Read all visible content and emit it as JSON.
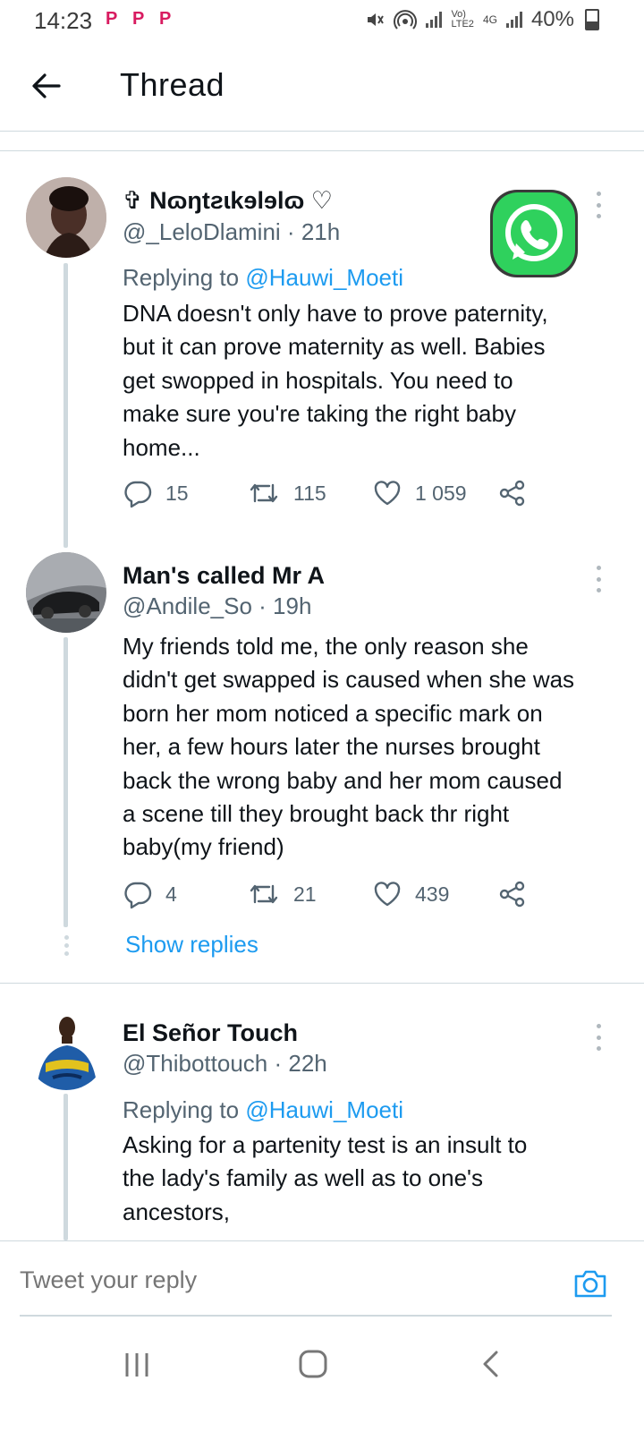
{
  "status": {
    "time": "14:23",
    "notification_icons": [
      "P",
      "P",
      "P"
    ],
    "network_label_top": "Vo)",
    "network_label_bottom": "LTE2",
    "network_type": "4G",
    "battery": "40%"
  },
  "header": {
    "title": "Thread",
    "back_icon": "arrow-left-icon"
  },
  "tweets": [
    {
      "name": "✞ Nɷŋtƨɩkɘlɘlɷ ♡",
      "handle": "@_LeloDlamini",
      "time": "21h",
      "replying_prefix": "Replying to",
      "replying_to": "@Hauwi_Moeti",
      "lines": [
        "DNA doesn't only have to prove paternity,",
        "but it can prove maternity as well. Babies",
        "get swopped in hospitals. You need to",
        "make sure you're taking the right baby",
        "home..."
      ],
      "replies": "15",
      "retweets": "115",
      "likes": "1 059"
    },
    {
      "name": "Man's called Mr A",
      "handle": "@Andile_So",
      "time": "19h",
      "lines": [
        "My friends told me, the only reason she",
        "didn't get swapped is caused when she was",
        "born her mom noticed a specific mark on",
        "her, a few hours later the nurses brought",
        "back the wrong baby and her mom caused",
        "a scene till they brought back thr right",
        "baby(my friend)"
      ],
      "replies": "4",
      "retweets": "21",
      "likes": "439",
      "show_replies": "Show replies"
    },
    {
      "name": "El Señor Touch",
      "handle": "@Thibottouch",
      "time": "22h",
      "replying_prefix": "Replying to",
      "replying_to": "@Hauwi_Moeti",
      "lines": [
        "Asking for a partenity test is an insult to",
        "the lady's family as well as to one's",
        "ancestors,"
      ]
    }
  ],
  "reply_bar": {
    "placeholder": "Tweet your reply",
    "camera_icon": "camera-icon"
  },
  "nav": {
    "recents_icon": "recents-icon",
    "home_icon": "home-icon",
    "back_icon": "back-nav-icon"
  },
  "colors": {
    "accent": "#1d9bf0",
    "secondary_text": "#536471",
    "primary_text": "#0f1419",
    "divider": "#cfd9de",
    "whatsapp_green": "#25d366"
  }
}
